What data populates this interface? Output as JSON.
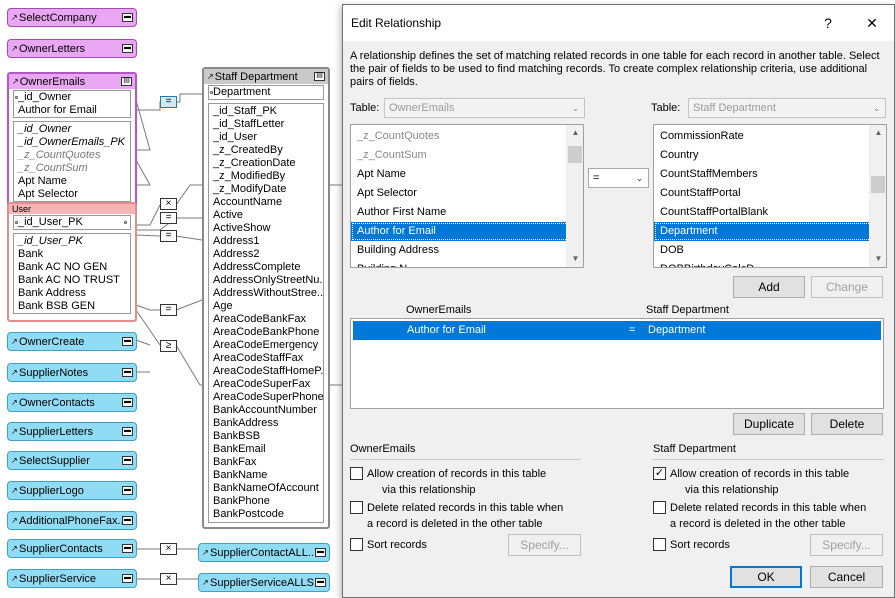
{
  "graph": {
    "pills_top": [
      {
        "label": "SelectCompany"
      },
      {
        "label": "OwnerLetters"
      }
    ],
    "owner_emails_box": {
      "title": "OwnerEmails",
      "keys": [
        "_id_Owner",
        "Author for Email"
      ],
      "fields": [
        "_id_Owner",
        "_id_OwnerEmails_PK",
        "_z_CountQuotes",
        "_z_CountSum",
        "Apt Name",
        "Apt Selector"
      ]
    },
    "user_box": {
      "title": "User",
      "keys": [
        "_id_User_PK"
      ],
      "fields": [
        "_id_User_PK",
        "Bank",
        "Bank AC NO GEN",
        "Bank AC NO TRUST",
        "Bank Address",
        "Bank BSB GEN"
      ]
    },
    "staff_box": {
      "title": "Staff Department",
      "keys": [
        "Department"
      ],
      "fields": [
        "_id_Staff_PK",
        "_id_StaffLetter",
        "_id_User",
        "_z_CreatedBy",
        "_z_CreationDate",
        "_z_ModifiedBy",
        "_z_ModifyDate",
        "AccountName",
        "Active",
        "ActiveShow",
        "Address1",
        "Address2",
        "AddressComplete",
        "AddressOnlyStreetNu...",
        "AddressWithoutStree...",
        "Age",
        "AreaCodeBankFax",
        "AreaCodeBankPhone",
        "AreaCodeEmergency",
        "AreaCodeStaffFax",
        "AreaCodeStaffHomeP...",
        "AreaCodeSuperFax",
        "AreaCodeSuperPhone",
        "BankAccountNumber",
        "BankAddress",
        "BankBSB",
        "BankEmail",
        "BankFax",
        "BankName",
        "BankNameOfAccount",
        "BankPhone",
        "BankPostcode"
      ]
    },
    "pills_left": [
      {
        "label": "OwnerCreate"
      },
      {
        "label": "SupplierNotes"
      },
      {
        "label": "OwnerContacts"
      },
      {
        "label": "SupplierLetters"
      },
      {
        "label": "SelectSupplier"
      },
      {
        "label": "SupplierLogo"
      },
      {
        "label": "AdditionalPhoneFax..."
      },
      {
        "label": "SupplierContacts"
      },
      {
        "label": "SupplierService"
      }
    ],
    "pills_right": [
      {
        "label": "SupplierContactALL..."
      },
      {
        "label": "SupplierServiceALLS..."
      }
    ],
    "rel_symbols": {
      "eq": "=",
      "x": "×",
      "ge": "≥"
    }
  },
  "dialog": {
    "title": "Edit Relationship",
    "help_label": "?",
    "close_label": "✕",
    "description": "A relationship defines the set of matching related records in one table for each record in another table. Select the pair of fields to be used to find matching records. To create complex relationship criteria, use additional pairs of fields.",
    "table_label": "Table:",
    "left_table": "OwnerEmails",
    "right_table": "Staff Department",
    "left_fields": [
      "_z_CountQuotes",
      "_z_CountSum",
      "Apt Name",
      "Apt Selector",
      "Author First Name",
      "Author for Email",
      "Building Address",
      "Building N..."
    ],
    "left_selected": "Author for Email",
    "right_fields": [
      "CommissionRate",
      "Country",
      "CountStaffMembers",
      "CountStaffPortal",
      "CountStaffPortalBlank",
      "Department",
      "DOB",
      "DOBBirthdayCalcD..."
    ],
    "right_selected": "Department",
    "operator": "=",
    "add_label": "Add",
    "change_label": "Change",
    "pairs_header_left": "OwnerEmails",
    "pairs_header_right": "Staff Department",
    "pair": {
      "left": "Author for Email",
      "op": "=",
      "right": "Department"
    },
    "duplicate_label": "Duplicate",
    "delete_label": "Delete",
    "left_section": {
      "title": "OwnerEmails",
      "allow_create_1": "Allow creation of records in this table",
      "allow_create_2": "via this relationship",
      "allow_create_checked": false,
      "delete_1": "Delete related records in this table when",
      "delete_2": "a record is deleted in the other table",
      "delete_checked": false,
      "sort": "Sort records",
      "sort_checked": false,
      "specify": "Specify..."
    },
    "right_section": {
      "title": "Staff Department",
      "allow_create_1": "Allow creation of records in this table",
      "allow_create_2": "via this relationship",
      "allow_create_checked": true,
      "delete_1": "Delete related records in this table when",
      "delete_2": "a record is deleted in the other table",
      "delete_checked": false,
      "sort": "Sort records",
      "sort_checked": false,
      "specify": "Specify..."
    },
    "ok_label": "OK",
    "cancel_label": "Cancel",
    "check_mark": "✓"
  }
}
